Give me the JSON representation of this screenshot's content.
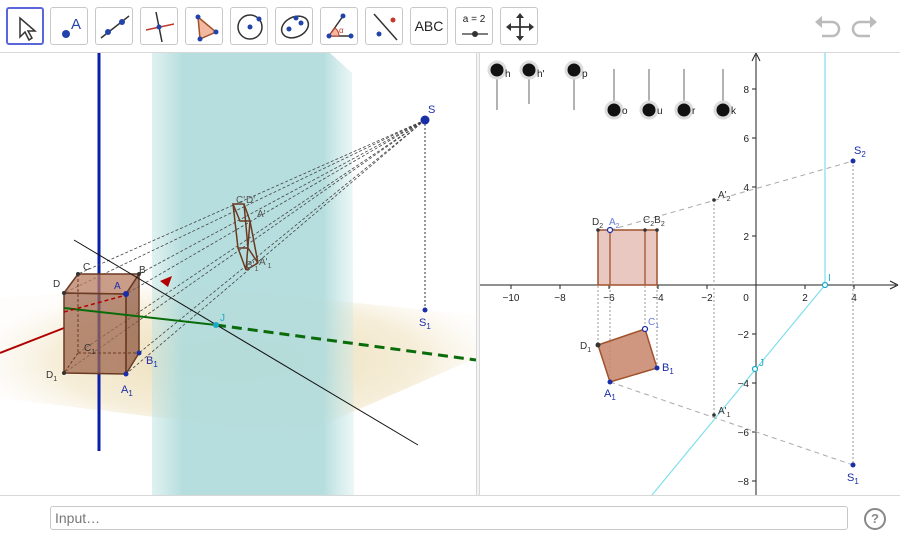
{
  "toolbar": {
    "text_tool_label": "ABC",
    "slider_tool_label": "a = 2"
  },
  "view3d": {
    "labels": {
      "S": "S",
      "S1": "S",
      "S1sub": "1",
      "A": "A",
      "A1": "A",
      "A1sub": "1",
      "B": "B",
      "B1": "B",
      "B1sub": "1",
      "C": "C",
      "C1": "C",
      "C1sub": "1",
      "D": "D",
      "D1": "D",
      "D1sub": "1",
      "J": "J",
      "Cp": "C'",
      "Dp": "D'",
      "Ap": "A'",
      "A1p": "A'",
      "A1psub": "1",
      "Bp1": "B'",
      "Bp1sub": "1"
    }
  },
  "view2d": {
    "sliders": [
      "h",
      "h'",
      "p",
      "o",
      "u",
      "r",
      "k"
    ],
    "x_axis": {
      "min": -12,
      "max": 5.9,
      "ticks": [
        -10,
        -8,
        -6,
        -4,
        -2,
        0,
        2,
        4
      ]
    },
    "y_axis": {
      "min": -8.7,
      "max": 9.3,
      "ticks": [
        -8,
        -6,
        -4,
        -2,
        2,
        4,
        6,
        8
      ]
    },
    "points": {
      "S2": {
        "label": "S",
        "sub": "2"
      },
      "S1": {
        "label": "S",
        "sub": "1"
      },
      "A2p": {
        "label": "A'",
        "sub": "2"
      },
      "A1p": {
        "label": "A'",
        "sub": "1"
      },
      "D2": {
        "label": "D",
        "sub": "2"
      },
      "A2": {
        "label": "A",
        "sub": "2"
      },
      "C2B2": {
        "label": "C",
        "sub": "2",
        "label2": "B",
        "sub2": "2"
      },
      "D1": {
        "label": "D",
        "sub": "1"
      },
      "A1": {
        "label": "A",
        "sub": "1"
      },
      "B1": {
        "label": "B",
        "sub": "1"
      },
      "C1": {
        "label": "C",
        "sub": "1"
      },
      "I": {
        "label": "I"
      },
      "J": {
        "label": "J"
      }
    }
  },
  "input": {
    "placeholder": "Input…"
  },
  "help": {
    "glyph": "?"
  }
}
